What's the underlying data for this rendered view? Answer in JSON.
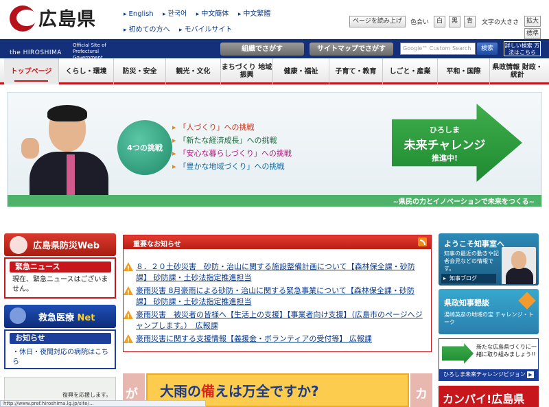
{
  "header": {
    "logo_text": "広島県",
    "lang_links": [
      "English",
      "한국어",
      "中文簡体",
      "中文繁體",
      "初めての方へ",
      "モバイルサイト"
    ],
    "read_aloud": "ページを読み上げ",
    "color_label": "色合い",
    "colors": [
      {
        "label": "白",
        "bg": "#ffffff",
        "fg": "#333333"
      },
      {
        "label": "黒",
        "bg": "#ffffff",
        "fg": "#333333"
      },
      {
        "label": "青",
        "bg": "#ffffff",
        "fg": "#333333"
      }
    ],
    "text_size_label": "文字の大きさ",
    "size_large": "拡大",
    "size_standard": "標準"
  },
  "bluebar": {
    "official_site": "the HIROSHIMA",
    "official_sub": "Official Site of Prefectural Government",
    "org_search": "組織でさがす",
    "sitemap_search": "サイトマップでさがす",
    "search_placeholder": "Google™ Custom Search",
    "search_button": "検索",
    "advanced_search": "詳しい検索 方法はこちら"
  },
  "nav": {
    "items": [
      "トップページ",
      "くらし・環境",
      "防災・安全",
      "観光・文化",
      "まちづくり 地域振興",
      "健康・福祉",
      "子育て・教育",
      "しごと・産業",
      "平和・国際",
      "県政情報 財政・統計"
    ]
  },
  "hero": {
    "badge": "4つの挑戦",
    "challenges": [
      "「人づくり」への挑戦",
      "「新たな経済成長」への挑戦",
      "「安心な暮らしづくり」への挑戦",
      "「豊かな地域づくり」への挑戦"
    ],
    "arrow_line1": "ひろしま",
    "arrow_line2": "未来チャレンジ",
    "arrow_line3": "推進中!",
    "footer": "~県民の力とイノベーションで未来をつくる~"
  },
  "left": {
    "bousai_title": "広島県防災Web",
    "urgent_title": "緊急ニュース",
    "urgent_text": "現在、緊急ニュースはございません。",
    "kyukyu_title": "救急医療",
    "kyukyu_net": "Net",
    "notice_title": "お知らせ",
    "notice_link": "休日・夜間対応の病院はこちら",
    "bottom_text": "復興を応援します。"
  },
  "important": {
    "title": "重要なお知らせ",
    "items": [
      "８．２０土砂災害　砂防・治山に関する施設整備計画について【森林保全課・砂防課】 砂防課・土砂法指定推進担当",
      "豪雨災害 8月豪雨による砂防・治山に関する緊急事業について【森林保全課・砂防課】 砂防課・土砂法指定推進担当",
      "豪雨災害　被災者の皆様へ【生活上の支援】【事業者向け支援】（広島市のページへジャンプします。）　広報課",
      "豪雨災害に関する支援情報【義援金・ボランティアの受付等】 広報課"
    ]
  },
  "center_banner": {
    "text_pre": "大雨の",
    "text_hi": "備",
    "text_post": "えは万全ですか?",
    "left_char": "が",
    "right_char": "カ"
  },
  "right": {
    "welcome_title": "ようこそ知事室へ",
    "welcome_desc": "知事の最近の動きや記者会見などの情報です。",
    "blog_button": "知事ブログ",
    "kondan_title": "県政知事懇談",
    "kondan_desc": "湯崎英彦の地域の宝 チャレンジ・トーク",
    "vision_desc": "新たな広島県づくりに一緒に取り組みましょう!!",
    "vision_bar": "ひろしま未来チャレンジビジョン",
    "kanpai": "カンパイ!広島県"
  },
  "statusbar": "http://www.pref.hiroshima.lg.jp/site/..."
}
